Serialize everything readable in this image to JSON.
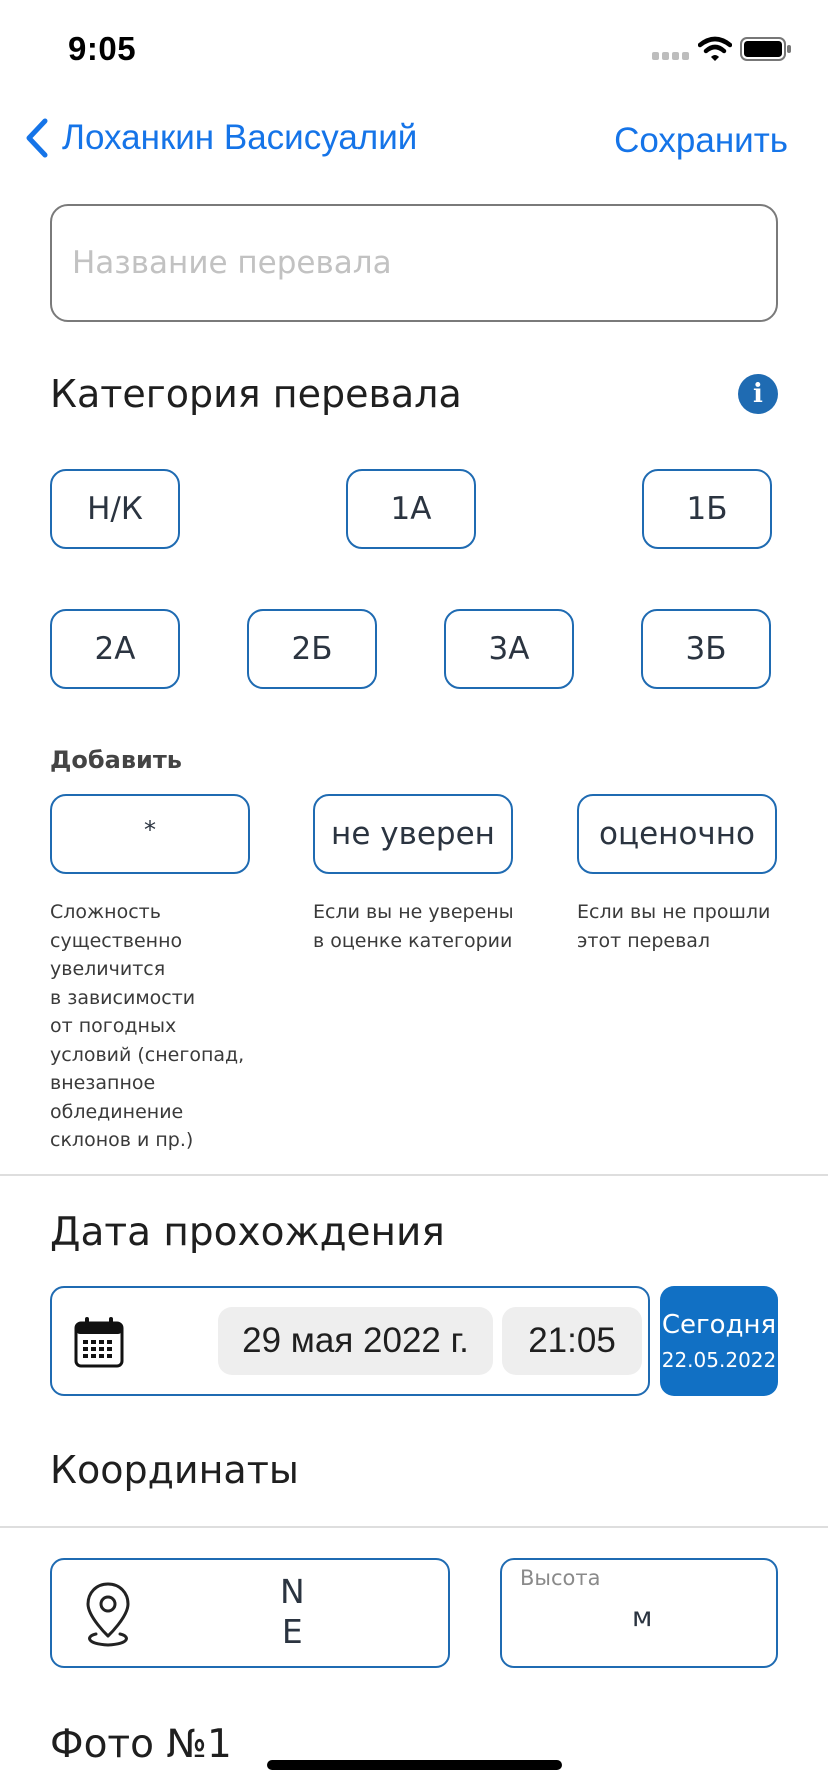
{
  "status_bar": {
    "time": "9:05",
    "icons": [
      "signal-icon",
      "wifi-icon",
      "battery-icon"
    ]
  },
  "nav": {
    "back_label": "Лоханкин Васисуалий",
    "save_label": "Сохранить"
  },
  "name_input": {
    "placeholder": "Название перевала",
    "value": ""
  },
  "category": {
    "title": "Категория перевала",
    "row1": [
      "Н/К",
      "1А",
      "1Б"
    ],
    "row2": [
      "2А",
      "2Б",
      "3А",
      "3Б"
    ]
  },
  "add": {
    "label": "Добавить",
    "options": [
      {
        "label": "*",
        "description": "Сложность\nсущественно\nувеличится\nв зависимости\nот погодных\nусловий (снегопад,\nвнезапное\nоблединение\nсклонов и пр.)"
      },
      {
        "label": "не уверен",
        "description": "Если вы не уверены\nв оценке категории"
      },
      {
        "label": "оценочно",
        "description": "Если вы не прошли\nэтот перевал"
      }
    ]
  },
  "date": {
    "title": "Дата прохождения",
    "date_value": "29 мая 2022 г.",
    "time_value": "21:05",
    "today_label": "Сегодня",
    "today_date": "22.05.2022"
  },
  "coordinates": {
    "title": "Координаты",
    "lat_suffix": "N",
    "lon_suffix": "E",
    "altitude_placeholder": "Высота",
    "altitude_unit": "м"
  },
  "photo": {
    "title": "Фото №1"
  },
  "colors": {
    "accent": "#1574e8",
    "brand": "#1f6bb2",
    "today_bg": "#1170c4"
  }
}
